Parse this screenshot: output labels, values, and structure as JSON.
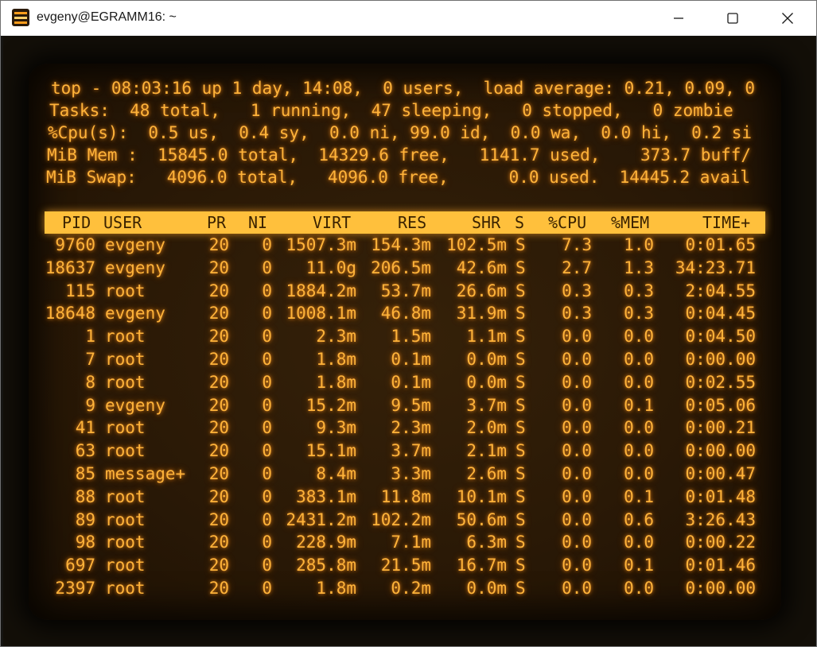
{
  "window": {
    "title": "evgeny@EGRAMM16: ~",
    "icon_label": "CRT",
    "controls": [
      "minimize-icon",
      "maximize-icon",
      "close-icon"
    ]
  },
  "summary": {
    "line1": "top - 08:03:16 up 1 day, 14:08,  0 users,  load average: 0.21, 0.09, 0",
    "line2": "Tasks:  48 total,   1 running,  47 sleeping,   0 stopped,   0 zombie",
    "line3": "%Cpu(s):  0.5 us,  0.4 sy,  0.0 ni, 99.0 id,  0.0 wa,  0.0 hi,  0.2 si",
    "line4": "MiB Mem :  15845.0 total,  14329.6 free,   1141.7 used,    373.7 buff/",
    "line5": "MiB Swap:   4096.0 total,   4096.0 free,      0.0 used.  14445.2 avail"
  },
  "columns": [
    "PID",
    "USER",
    "PR",
    "NI",
    "VIRT",
    "RES",
    "SHR",
    "S",
    "%CPU",
    "%MEM",
    "TIME+"
  ],
  "processes": [
    [
      "9760",
      "evgeny",
      "20",
      "0",
      "1507.3m",
      "154.3m",
      "102.5m",
      "S",
      "7.3",
      "1.0",
      "0:01.65"
    ],
    [
      "18637",
      "evgeny",
      "20",
      "0",
      "11.0g",
      "206.5m",
      "42.6m",
      "S",
      "2.7",
      "1.3",
      "34:23.71"
    ],
    [
      "115",
      "root",
      "20",
      "0",
      "1884.2m",
      "53.7m",
      "26.6m",
      "S",
      "0.3",
      "0.3",
      "2:04.55"
    ],
    [
      "18648",
      "evgeny",
      "20",
      "0",
      "1008.1m",
      "46.8m",
      "31.9m",
      "S",
      "0.3",
      "0.3",
      "0:04.45"
    ],
    [
      "1",
      "root",
      "20",
      "0",
      "2.3m",
      "1.5m",
      "1.1m",
      "S",
      "0.0",
      "0.0",
      "0:04.50"
    ],
    [
      "7",
      "root",
      "20",
      "0",
      "1.8m",
      "0.1m",
      "0.0m",
      "S",
      "0.0",
      "0.0",
      "0:00.00"
    ],
    [
      "8",
      "root",
      "20",
      "0",
      "1.8m",
      "0.1m",
      "0.0m",
      "S",
      "0.0",
      "0.0",
      "0:02.55"
    ],
    [
      "9",
      "evgeny",
      "20",
      "0",
      "15.2m",
      "9.5m",
      "3.7m",
      "S",
      "0.0",
      "0.1",
      "0:05.06"
    ],
    [
      "41",
      "root",
      "20",
      "0",
      "9.3m",
      "2.3m",
      "2.0m",
      "S",
      "0.0",
      "0.0",
      "0:00.21"
    ],
    [
      "63",
      "root",
      "20",
      "0",
      "15.1m",
      "3.7m",
      "2.1m",
      "S",
      "0.0",
      "0.0",
      "0:00.00"
    ],
    [
      "85",
      "message+",
      "20",
      "0",
      "8.4m",
      "3.3m",
      "2.6m",
      "S",
      "0.0",
      "0.0",
      "0:00.47"
    ],
    [
      "88",
      "root",
      "20",
      "0",
      "383.1m",
      "11.8m",
      "10.1m",
      "S",
      "0.0",
      "0.1",
      "0:01.48"
    ],
    [
      "89",
      "root",
      "20",
      "0",
      "2431.2m",
      "102.2m",
      "50.6m",
      "S",
      "0.0",
      "0.6",
      "3:26.43"
    ],
    [
      "98",
      "root",
      "20",
      "0",
      "228.9m",
      "7.1m",
      "6.3m",
      "S",
      "0.0",
      "0.0",
      "0:00.22"
    ],
    [
      "697",
      "root",
      "20",
      "0",
      "285.8m",
      "21.5m",
      "16.7m",
      "S",
      "0.0",
      "0.1",
      "0:01.46"
    ],
    [
      "2397",
      "root",
      "20",
      "0",
      "1.8m",
      "0.2m",
      "0.0m",
      "S",
      "0.0",
      "0.0",
      "0:00.00"
    ]
  ],
  "colors": {
    "phosphor": "#ffb33a",
    "header_bar": "#ffc03c",
    "screen_bg": "#2a1906"
  }
}
